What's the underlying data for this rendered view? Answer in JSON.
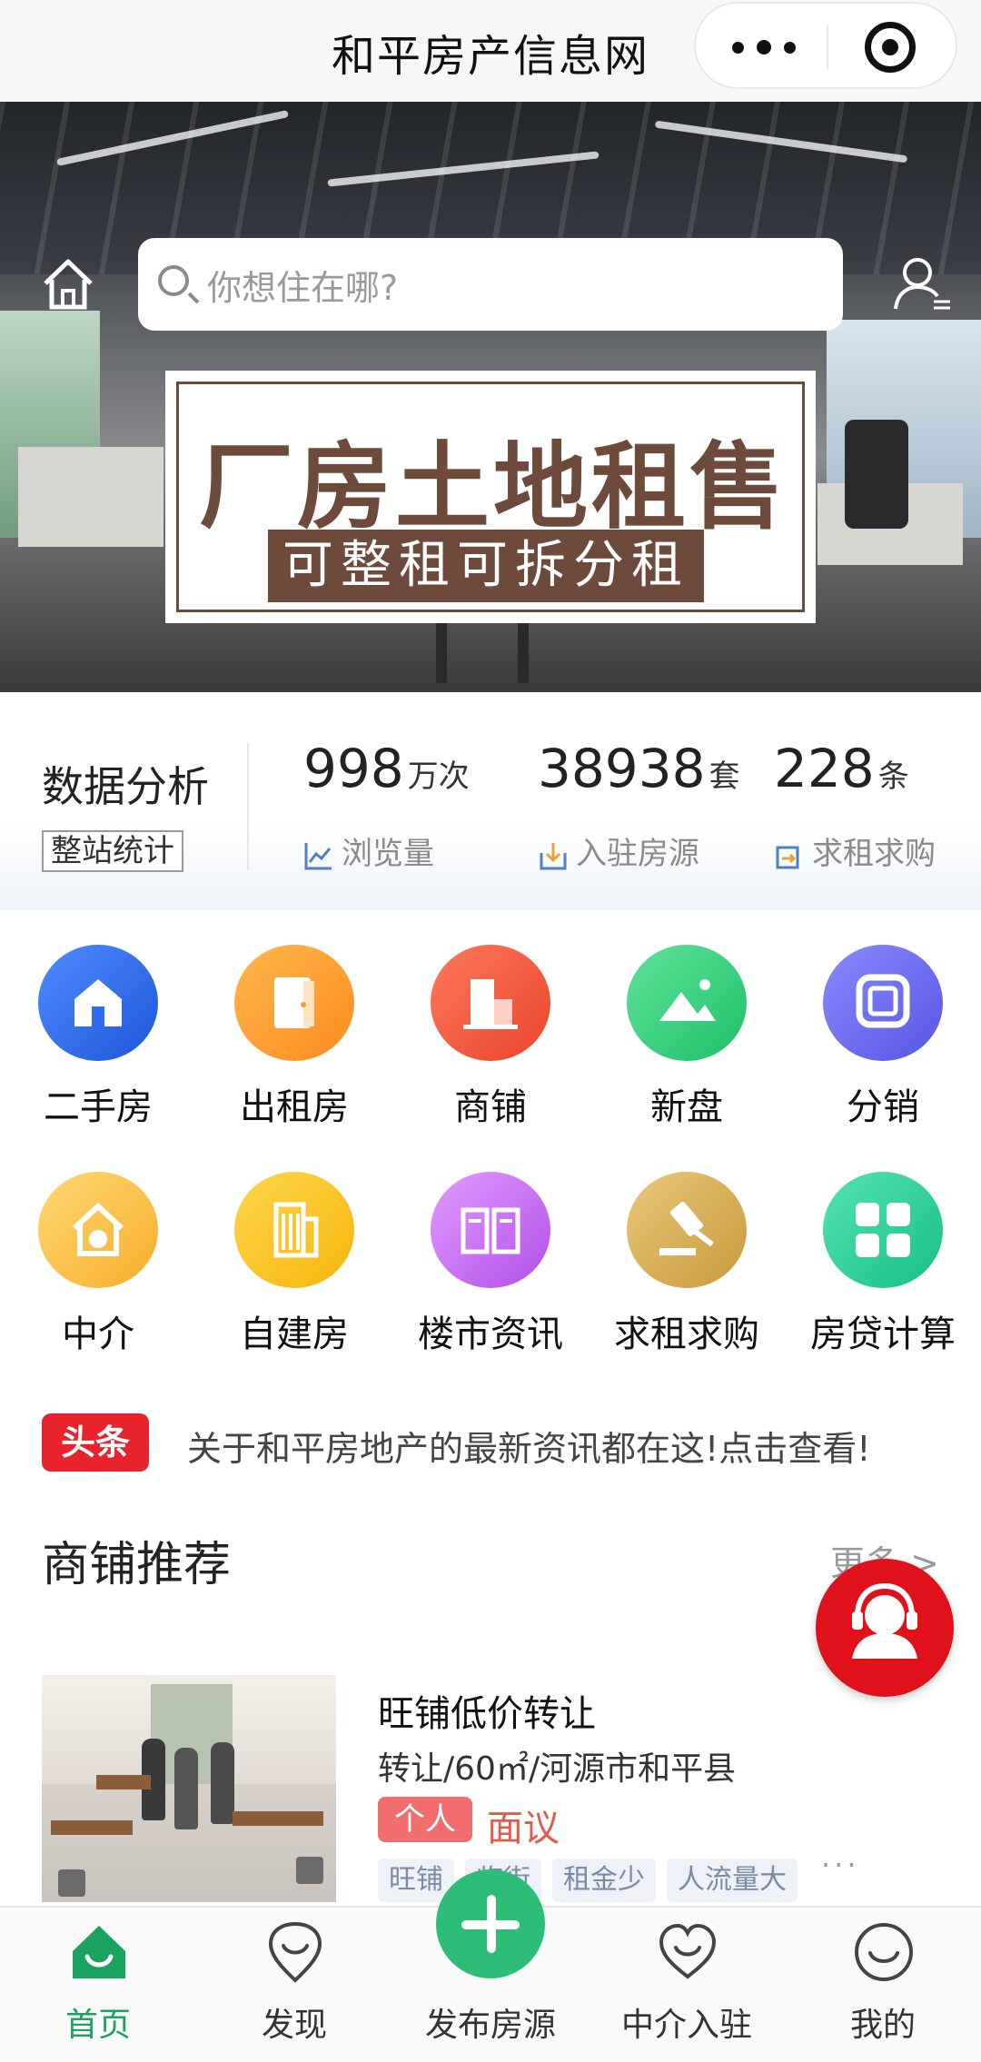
{
  "app": {
    "title": "和平房产信息网"
  },
  "search": {
    "placeholder": "你想住在哪?"
  },
  "banner": {
    "headline": "厂房土地租售",
    "subline": "可整租可拆分租"
  },
  "stats": {
    "label": "数据分析",
    "tag": "整站统计",
    "items": [
      {
        "value": "998",
        "unit": "万次",
        "caption": "浏览量",
        "icon": "chart-icon"
      },
      {
        "value": "38938",
        "unit": "套",
        "caption": "入驻房源",
        "icon": "download-icon"
      },
      {
        "value": "228",
        "unit": "条",
        "caption": "求租求购",
        "icon": "transfer-icon"
      }
    ]
  },
  "categories": [
    {
      "label": "二手房",
      "icon": "house-icon",
      "color": "#2f6bf0"
    },
    {
      "label": "出租房",
      "icon": "door-icon",
      "color": "#ff9b2a"
    },
    {
      "label": "商铺",
      "icon": "shop-icon",
      "color": "#f25a3c"
    },
    {
      "label": "新盘",
      "icon": "mountain-icon",
      "color": "#2fcf7a"
    },
    {
      "label": "分销",
      "icon": "square-icon",
      "color": "#6e6ff0"
    },
    {
      "label": "中介",
      "icon": "agent-house-icon",
      "color": "#f7c044"
    },
    {
      "label": "自建房",
      "icon": "building-icon",
      "color": "#f7c21f"
    },
    {
      "label": "楼市资讯",
      "icon": "book-icon",
      "color": "#c66ef2"
    },
    {
      "label": "求租求购",
      "icon": "gavel-icon",
      "color": "#d8b25a"
    },
    {
      "label": "房贷计算",
      "icon": "calculator-icon",
      "color": "#2fd09b"
    }
  ],
  "headline": {
    "badge": "头条",
    "text": "关于和平房地产的最新资讯都在这!点击查看!"
  },
  "section": {
    "title": "商铺推荐",
    "more": "更多 >"
  },
  "listing": {
    "title": "旺铺低价转让",
    "meta": "转让/60㎡/河源市和平县",
    "owner_badge": "个人",
    "price": "面议",
    "tags": [
      "旺铺",
      "临街",
      "租金少",
      "人流量大"
    ],
    "more": "···"
  },
  "tabbar": {
    "tabs": [
      {
        "label": "首页",
        "icon": "home-icon",
        "active": true
      },
      {
        "label": "发现",
        "icon": "discover-icon",
        "active": false
      },
      {
        "label": "发布房源",
        "icon": "plus-icon",
        "active": false
      },
      {
        "label": "中介入驻",
        "icon": "heart-icon",
        "active": false
      },
      {
        "label": "我的",
        "icon": "smile-icon",
        "active": false
      }
    ]
  },
  "colors": {
    "accent": "#1aa35f",
    "headline_badge": "#e8232b",
    "price": "#e45a4a",
    "promo_brown": "#6d4a3a"
  }
}
